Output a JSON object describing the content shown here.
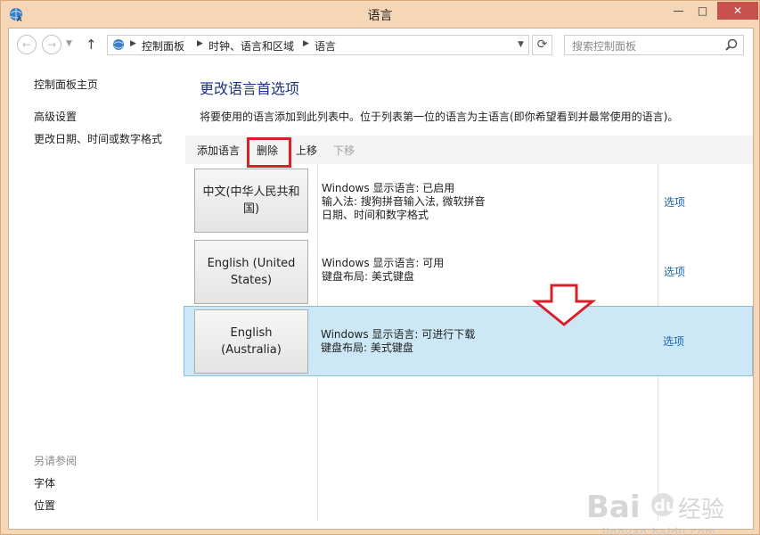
{
  "window": {
    "title": "语言",
    "minimize": "—",
    "maximize": "□",
    "close": "✕"
  },
  "nav": {
    "back": "←",
    "forward": "→",
    "up": "↑",
    "breadcrumbs": [
      "控制面板",
      "时钟、语言和区域",
      "语言"
    ],
    "refresh": "⟳",
    "search_placeholder": "搜索控制面板"
  },
  "sidebar": {
    "home": "控制面板主页",
    "links": [
      "高级设置",
      "更改日期、时间或数字格式"
    ],
    "see_also_label": "另请参阅",
    "see_also": [
      "字体",
      "位置"
    ]
  },
  "main": {
    "title": "更改语言首选项",
    "description": "将要使用的语言添加到此列表中。位于列表第一位的语言为主语言(即你希望看到并最常使用的语言)。",
    "toolbar": {
      "add": "添加语言",
      "remove": "删除",
      "up": "上移",
      "down": "下移"
    },
    "languages": [
      {
        "name": "中文(中华人民共和国)",
        "info": [
          "Windows 显示语言: 已启用",
          "输入法: 搜狗拼音输入法, 微软拼音",
          "日期、时间和数字格式"
        ],
        "option": "选项"
      },
      {
        "name": "English (United States)",
        "info": [
          "Windows 显示语言: 可用",
          "键盘布局: 美式键盘"
        ],
        "option": "选项"
      },
      {
        "name": "English (Australia)",
        "info": [
          "Windows 显示语言: 可进行下载",
          "键盘布局: 美式键盘"
        ],
        "option": "选项",
        "selected": true
      }
    ]
  },
  "watermark": {
    "text": "jingyan.baidu.com"
  },
  "colors": {
    "accent_link": "#1a66b4",
    "title_blue": "#1e3287",
    "highlight_red": "#d8202b",
    "selected_bg": "#cce8f6"
  }
}
